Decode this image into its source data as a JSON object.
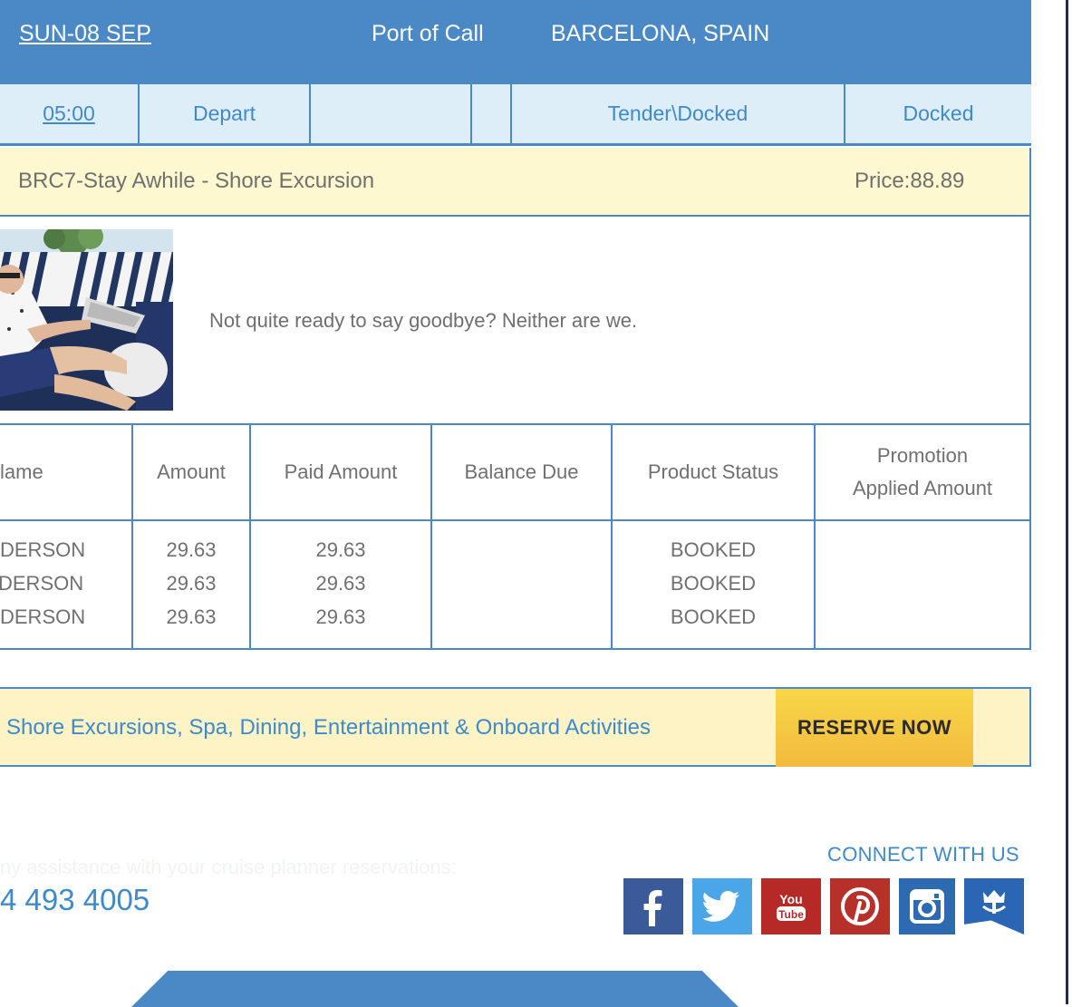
{
  "header": {
    "date": "SUN-08 SEP",
    "port_label": "Port of Call",
    "city": "BARCELONA, SPAIN"
  },
  "time_row": {
    "time": "05:00",
    "action": "Depart",
    "col3": "",
    "col4": "",
    "tender_docked": "Tender\\Docked",
    "status": "Docked"
  },
  "excursion": {
    "name": "BRC7-Stay Awhile - Shore Excursion",
    "price": "Price:88.89",
    "description": "Not quite ready to say goodbye? Neither are we."
  },
  "table": {
    "headers": {
      "name": "lame",
      "amount": "Amount",
      "paid": "Paid Amount",
      "balance": "Balance Due",
      "status": "Product Status",
      "promo_line1": "Promotion",
      "promo_line2": "Applied Amount"
    },
    "rows": [
      {
        "name": "DERSON",
        "amount": "29.63",
        "paid": "29.63",
        "status": "BOOKED"
      },
      {
        "name": "DERSON",
        "amount": "29.63",
        "paid": "29.63",
        "status": "BOOKED"
      },
      {
        "name": "DERSON",
        "amount": "29.63",
        "paid": "29.63",
        "status": "BOOKED"
      }
    ]
  },
  "reserve": {
    "link_text": "Shore Excursions, Spa, Dining, Entertainment & Onboard Activities",
    "button": "RESERVE NOW"
  },
  "footer": {
    "assist_text": "ny assistance with your cruise planner reservations:",
    "phone": "4 493 4005",
    "connect": "CONNECT WITH US",
    "social": [
      {
        "icon": "facebook-icon",
        "color": "#3b5a9a"
      },
      {
        "icon": "twitter-icon",
        "color": "#4aa6e6"
      },
      {
        "icon": "youtube-icon",
        "color": "#b52a26"
      },
      {
        "icon": "pinterest-icon",
        "color": "#b7302a"
      },
      {
        "icon": "instagram-icon",
        "color": "#2d6ab1"
      },
      {
        "icon": "royal-caribbean-crown-anchor-icon",
        "color": "#2a66b4"
      }
    ]
  },
  "colors": {
    "header_blue": "#4a89c5",
    "link_blue": "#3e8acb",
    "light_blue_row": "#deeef9",
    "cream": "#fdf8d0",
    "reserve_bg": "#fdf3c5",
    "button_yellow": "#f5c842"
  }
}
